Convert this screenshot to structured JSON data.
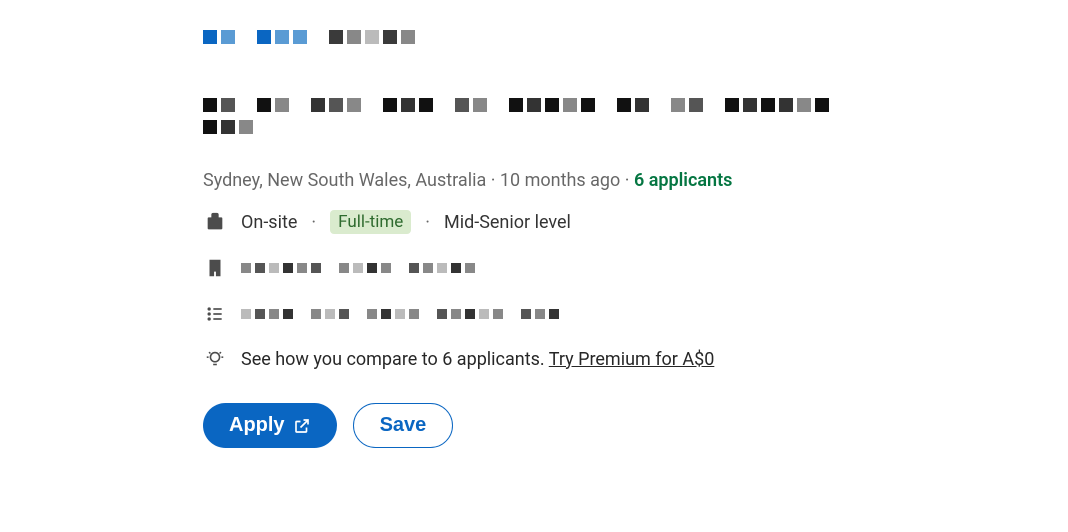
{
  "meta": {
    "location": "Sydney, New South Wales, Australia",
    "posted": "10 months ago",
    "applicants": "6 applicants"
  },
  "job": {
    "workplace_type": "On-site",
    "employment_type": "Full-time",
    "seniority": "Mid-Senior level"
  },
  "premium": {
    "compare_text": "See how you compare to 6 applicants.",
    "cta": "Try Premium for A$0"
  },
  "actions": {
    "apply": "Apply",
    "save": "Save"
  }
}
